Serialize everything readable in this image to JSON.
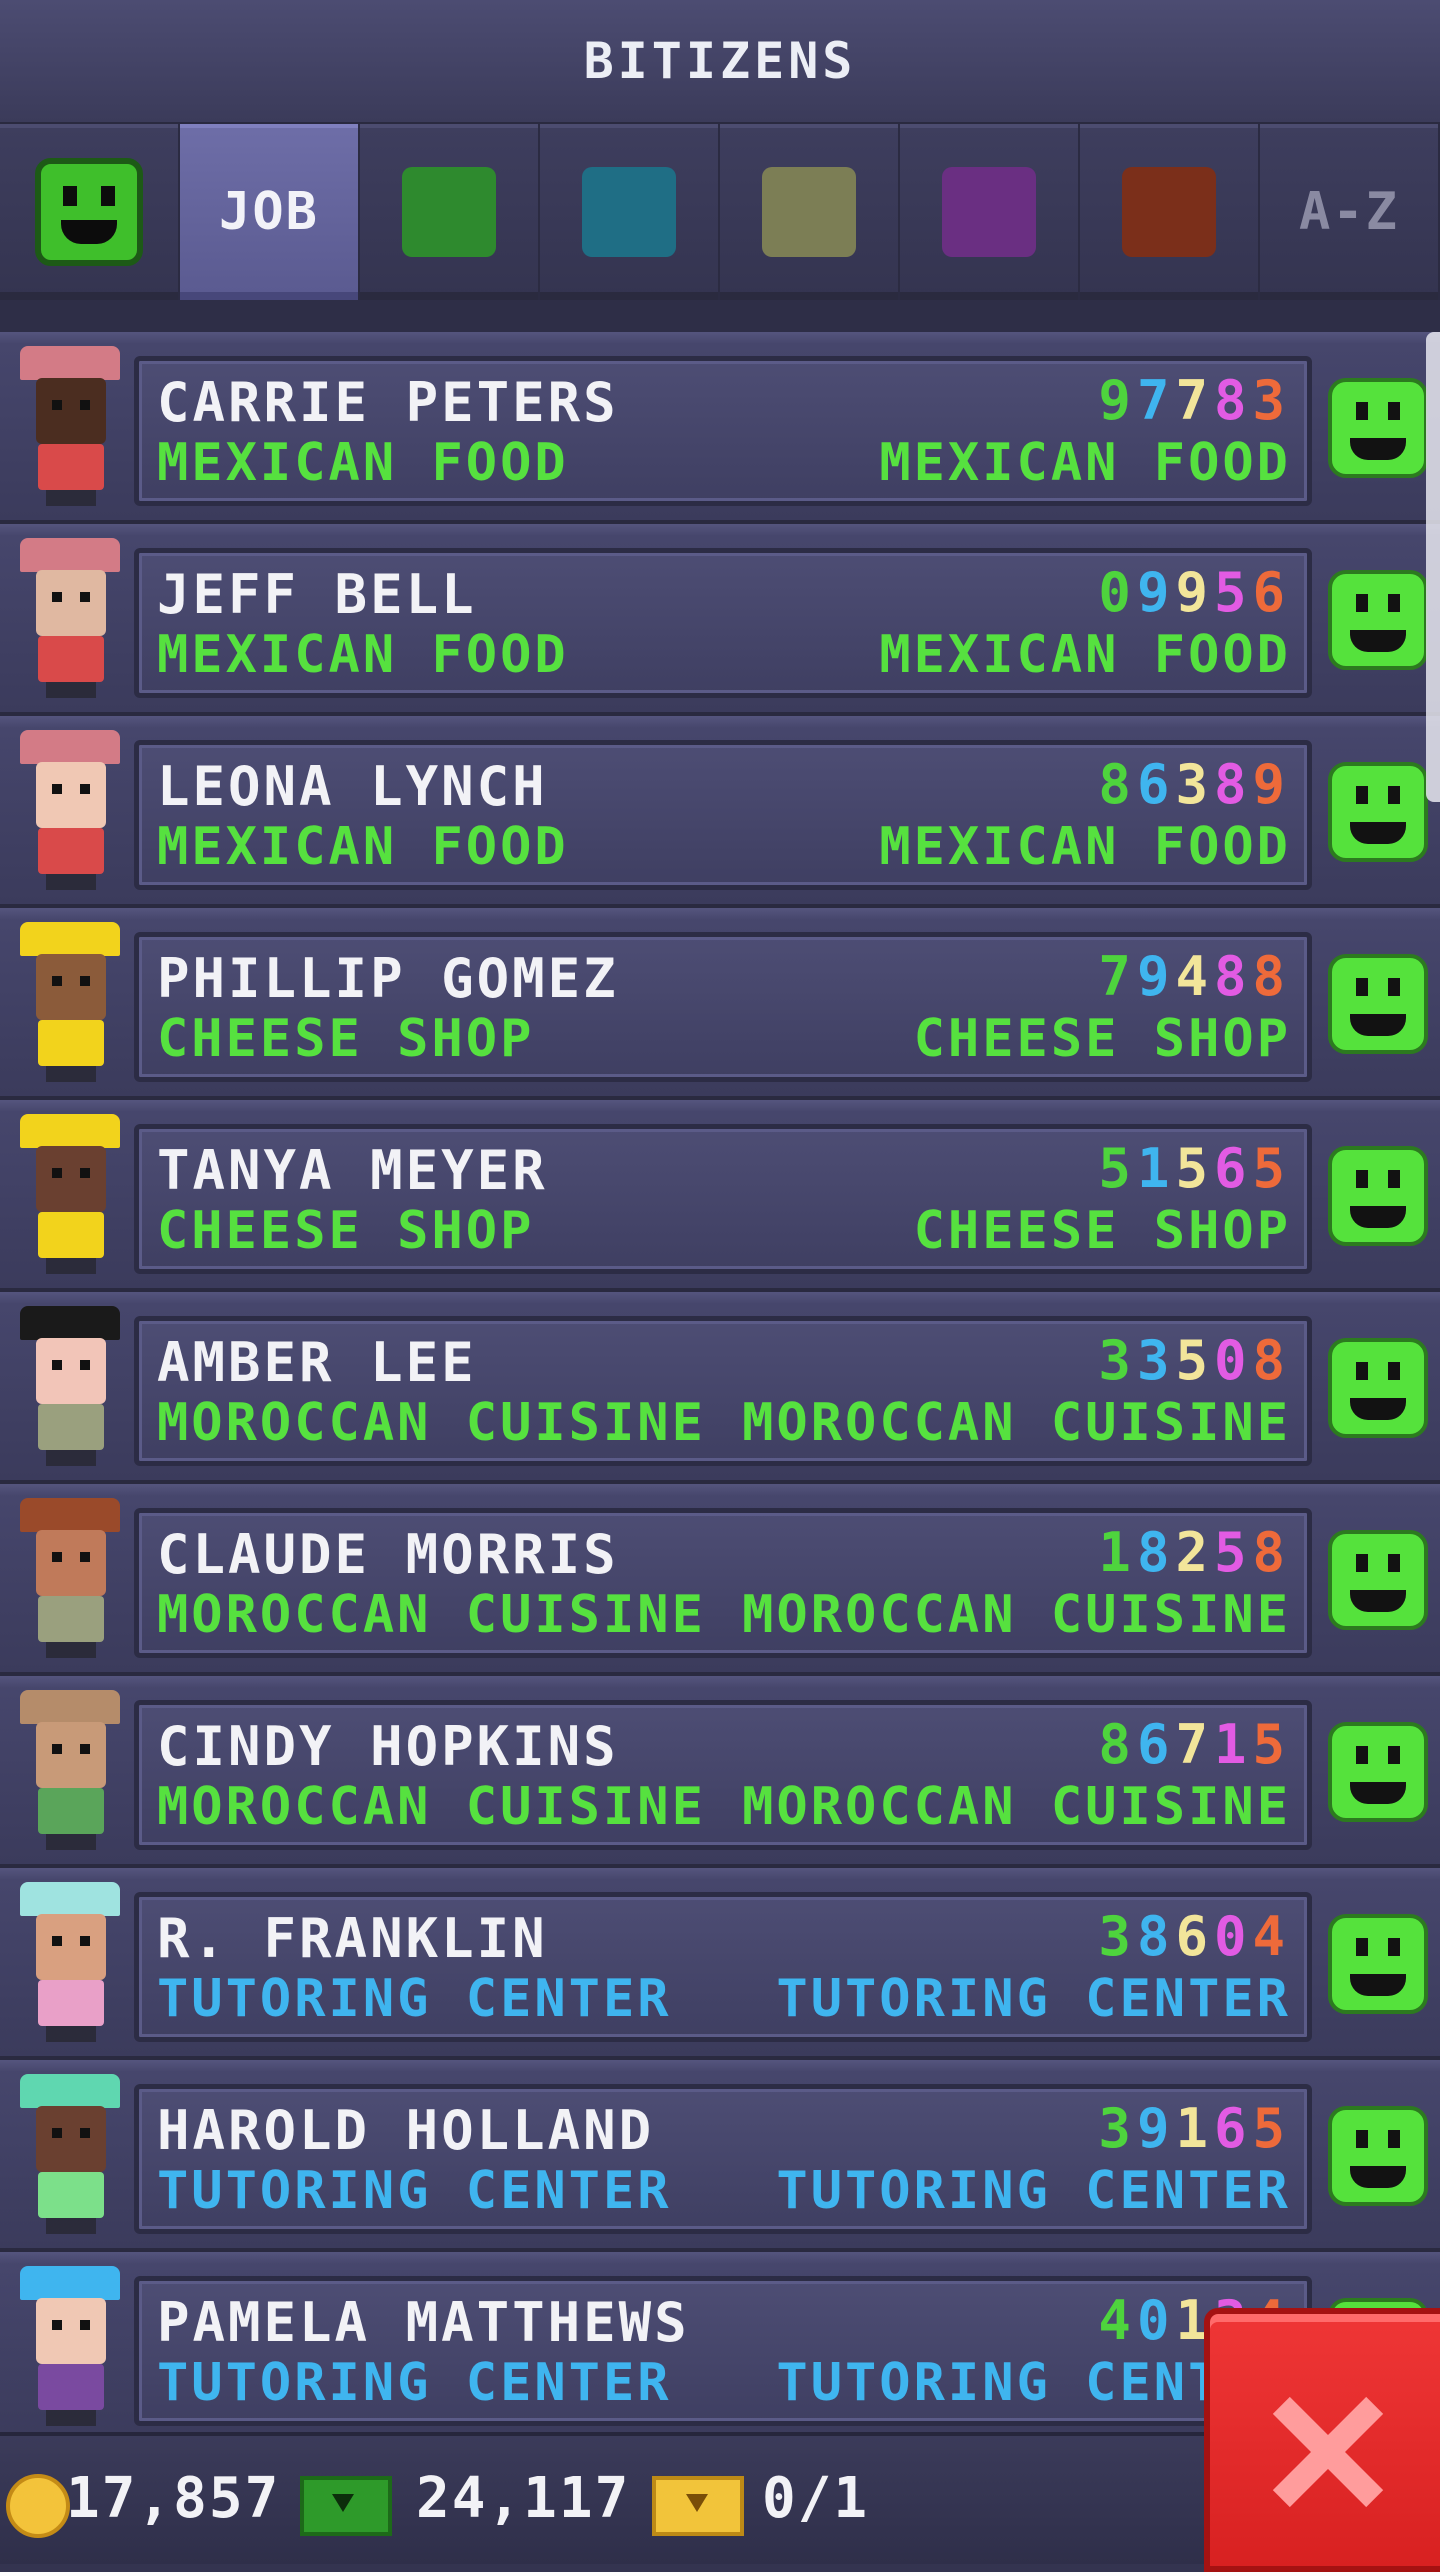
{
  "header": {
    "title": "BITIZENS"
  },
  "tabs": [
    {
      "kind": "mood",
      "icon": "smiley-icon"
    },
    {
      "kind": "text",
      "label": "JOB",
      "active": true
    },
    {
      "kind": "swatch",
      "color": "#2e8a2e"
    },
    {
      "kind": "swatch",
      "color": "#1f6e85"
    },
    {
      "kind": "swatch",
      "color": "#7c7e55"
    },
    {
      "kind": "swatch",
      "color": "#6a2f82"
    },
    {
      "kind": "swatch",
      "color": "#7b2f1a"
    },
    {
      "kind": "text",
      "label": "A-Z",
      "dim": true
    }
  ],
  "rows": [
    {
      "name": "CARRIE PETERS",
      "digits": [
        "9",
        "7",
        "7",
        "8",
        "3"
      ],
      "job": "MEXICAN FOOD",
      "dream": "MEXICAN FOOD",
      "job_color": "#56e13f",
      "avatar": {
        "hat": "#d37b86",
        "skin": "#4b2d20",
        "body": "#d94a4a"
      }
    },
    {
      "name": "JEFF BELL",
      "digits": [
        "0",
        "9",
        "9",
        "5",
        "6"
      ],
      "job": "MEXICAN FOOD",
      "dream": "MEXICAN FOOD",
      "job_color": "#56e13f",
      "avatar": {
        "hat": "#d37b86",
        "skin": "#e0b8a1",
        "body": "#d94a4a"
      }
    },
    {
      "name": "LEONA LYNCH",
      "digits": [
        "8",
        "6",
        "3",
        "8",
        "9"
      ],
      "job": "MEXICAN FOOD",
      "dream": "MEXICAN FOOD",
      "job_color": "#56e13f",
      "avatar": {
        "hat": "#d37b86",
        "skin": "#f0c8b4",
        "body": "#d94a4a"
      }
    },
    {
      "name": "PHILLIP GOMEZ",
      "digits": [
        "7",
        "9",
        "4",
        "8",
        "8"
      ],
      "job": "CHEESE SHOP",
      "dream": "CHEESE SHOP",
      "job_color": "#56e13f",
      "avatar": {
        "hat": "#f2d31c",
        "skin": "#8b5b3a",
        "body": "#f2d31c"
      }
    },
    {
      "name": "TANYA MEYER",
      "digits": [
        "5",
        "1",
        "5",
        "6",
        "5"
      ],
      "job": "CHEESE SHOP",
      "dream": "CHEESE SHOP",
      "job_color": "#56e13f",
      "avatar": {
        "hat": "#f2d31c",
        "skin": "#6a4030",
        "body": "#f2d31c"
      }
    },
    {
      "name": "AMBER LEE",
      "digits": [
        "3",
        "3",
        "5",
        "0",
        "8"
      ],
      "job": "MOROCCAN CUISINE",
      "dream": "MOROCCAN CUISINE",
      "job_color": "#56e13f",
      "avatar": {
        "hat": "#1a1a1a",
        "skin": "#f2c5b8",
        "body": "#9aa07e"
      }
    },
    {
      "name": "CLAUDE MORRIS",
      "digits": [
        "1",
        "8",
        "2",
        "5",
        "8"
      ],
      "job": "MOROCCAN CUISINE",
      "dream": "MOROCCAN CUISINE",
      "job_color": "#56e13f",
      "avatar": {
        "hat": "#9a4a2a",
        "skin": "#c07a5a",
        "body": "#9aa07e"
      }
    },
    {
      "name": "CINDY HOPKINS",
      "digits": [
        "8",
        "6",
        "7",
        "1",
        "5"
      ],
      "job": "MOROCCAN CUISINE",
      "dream": "MOROCCAN CUISINE",
      "job_color": "#56e13f",
      "avatar": {
        "hat": "#b58c6a",
        "skin": "#c89a78",
        "body": "#5aa55a"
      }
    },
    {
      "name": "R. FRANKLIN",
      "digits": [
        "3",
        "8",
        "6",
        "0",
        "4"
      ],
      "job": "TUTORING CENTER",
      "dream": "TUTORING CENTER",
      "job_color": "#3fb5ef",
      "avatar": {
        "hat": "#9fe3e0",
        "skin": "#d9a080",
        "body": "#e9a0c8"
      }
    },
    {
      "name": "HAROLD HOLLAND",
      "digits": [
        "3",
        "9",
        "1",
        "6",
        "5"
      ],
      "job": "TUTORING CENTER",
      "dream": "TUTORING CENTER",
      "job_color": "#3fb5ef",
      "avatar": {
        "hat": "#5fd7b0",
        "skin": "#6a4030",
        "body": "#7ce08a"
      }
    },
    {
      "name": "PAMELA MATTHEWS",
      "digits": [
        "4",
        "0",
        "1",
        "3",
        "4"
      ],
      "job": "TUTORING CENTER",
      "dream": "TUTORING CENTER",
      "job_color": "#3fb5ef",
      "avatar": {
        "hat": "#3fb5ef",
        "skin": "#f0c8b4",
        "body": "#7a4aa0"
      }
    }
  ],
  "footer": {
    "coins": "17,857",
    "bux": "24,117",
    "vip": "0/1"
  },
  "colors": {
    "happy": "#55e23c",
    "close": "#e12a2a"
  }
}
